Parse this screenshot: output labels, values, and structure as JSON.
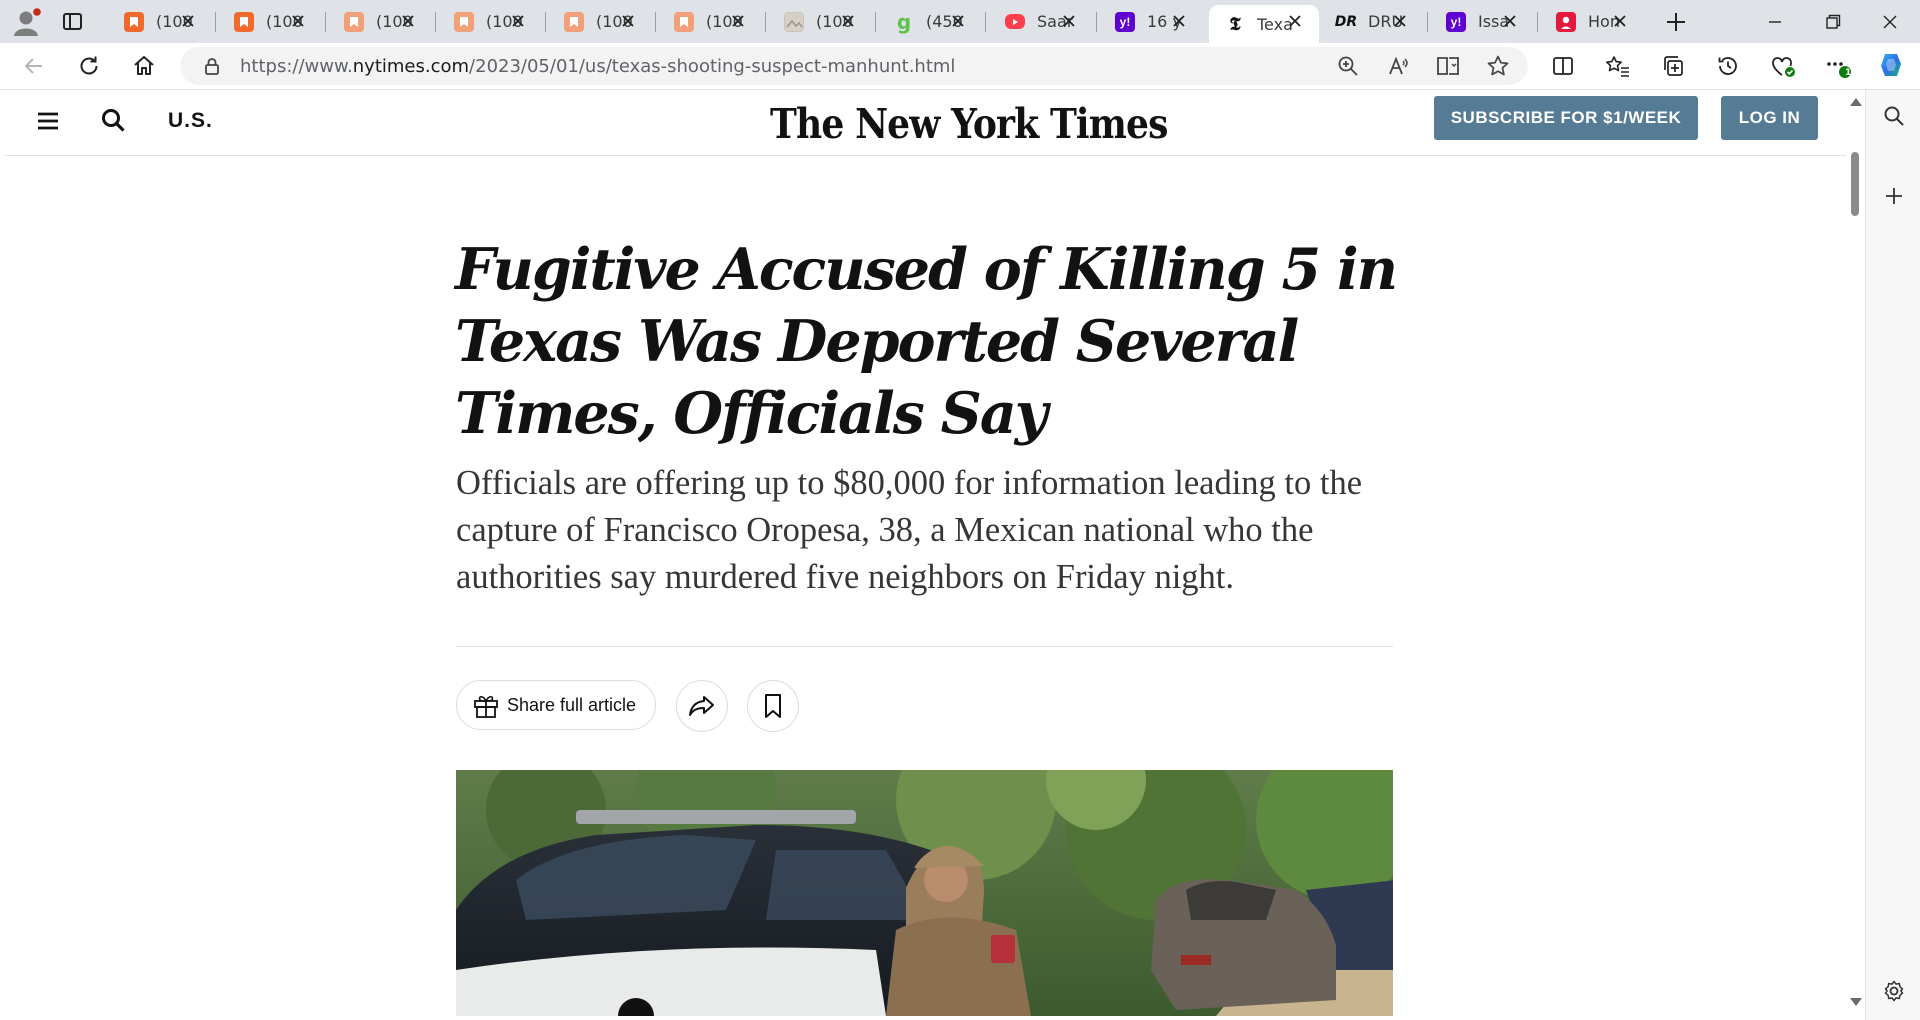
{
  "browser": {
    "tabs": [
      {
        "title": "(100",
        "icon": "orange-bookmark-icon",
        "color": "#ef6a2c"
      },
      {
        "title": "(100",
        "icon": "orange-bookmark-icon",
        "color": "#ef6a2c"
      },
      {
        "title": "(100",
        "icon": "orange-bookmark-icon",
        "color": "#f2a07a"
      },
      {
        "title": "(100",
        "icon": "orange-bookmark-icon",
        "color": "#f2a07a"
      },
      {
        "title": "(100",
        "icon": "orange-bookmark-icon",
        "color": "#f2a07a"
      },
      {
        "title": "(100",
        "icon": "orange-bookmark-icon",
        "color": "#f2a07a"
      },
      {
        "title": "(100",
        "icon": "gray-thumbnail-icon",
        "color": "#c9c3bb"
      },
      {
        "title": "(450",
        "icon": "green-g-icon",
        "color": "#5fc24a"
      },
      {
        "title": "Saar",
        "icon": "youtube-icon",
        "color": "#ff3d4d"
      },
      {
        "title": "16 y",
        "icon": "yahoo-icon",
        "color": "#5f01d1"
      },
      {
        "title": "Texa",
        "icon": "nyt-icon",
        "color": "#121212"
      },
      {
        "title": "DRU",
        "icon": "drudge-icon",
        "color": "#121212"
      },
      {
        "title": "Issa",
        "icon": "yahoo-icon",
        "color": "#5f01d1"
      },
      {
        "title": "Hon",
        "icon": "red-profile-icon",
        "color": "#e4193c"
      }
    ],
    "url_prefix": "https://www.",
    "url_domain": "nytimes.com",
    "url_path": "/2023/05/01/us/texas-shooting-suspect-manhunt.html",
    "extension_badge": "1"
  },
  "nyt": {
    "section": "U.S.",
    "logo": "The New York Times",
    "subscribe_label": "SUBSCRIBE FOR $1/WEEK",
    "login_label": "LOG IN"
  },
  "article": {
    "headline": "Fugitive Accused of Killing 5 in Texas Was Deported Several Times, Officials Say",
    "summary": "Officials are offering up to $80,000 for information leading to the capture of Francisco Oropesa, 38, a Mexican national who the authorities say murdered five neighbors on Friday night.",
    "share_label": "Share full article"
  }
}
